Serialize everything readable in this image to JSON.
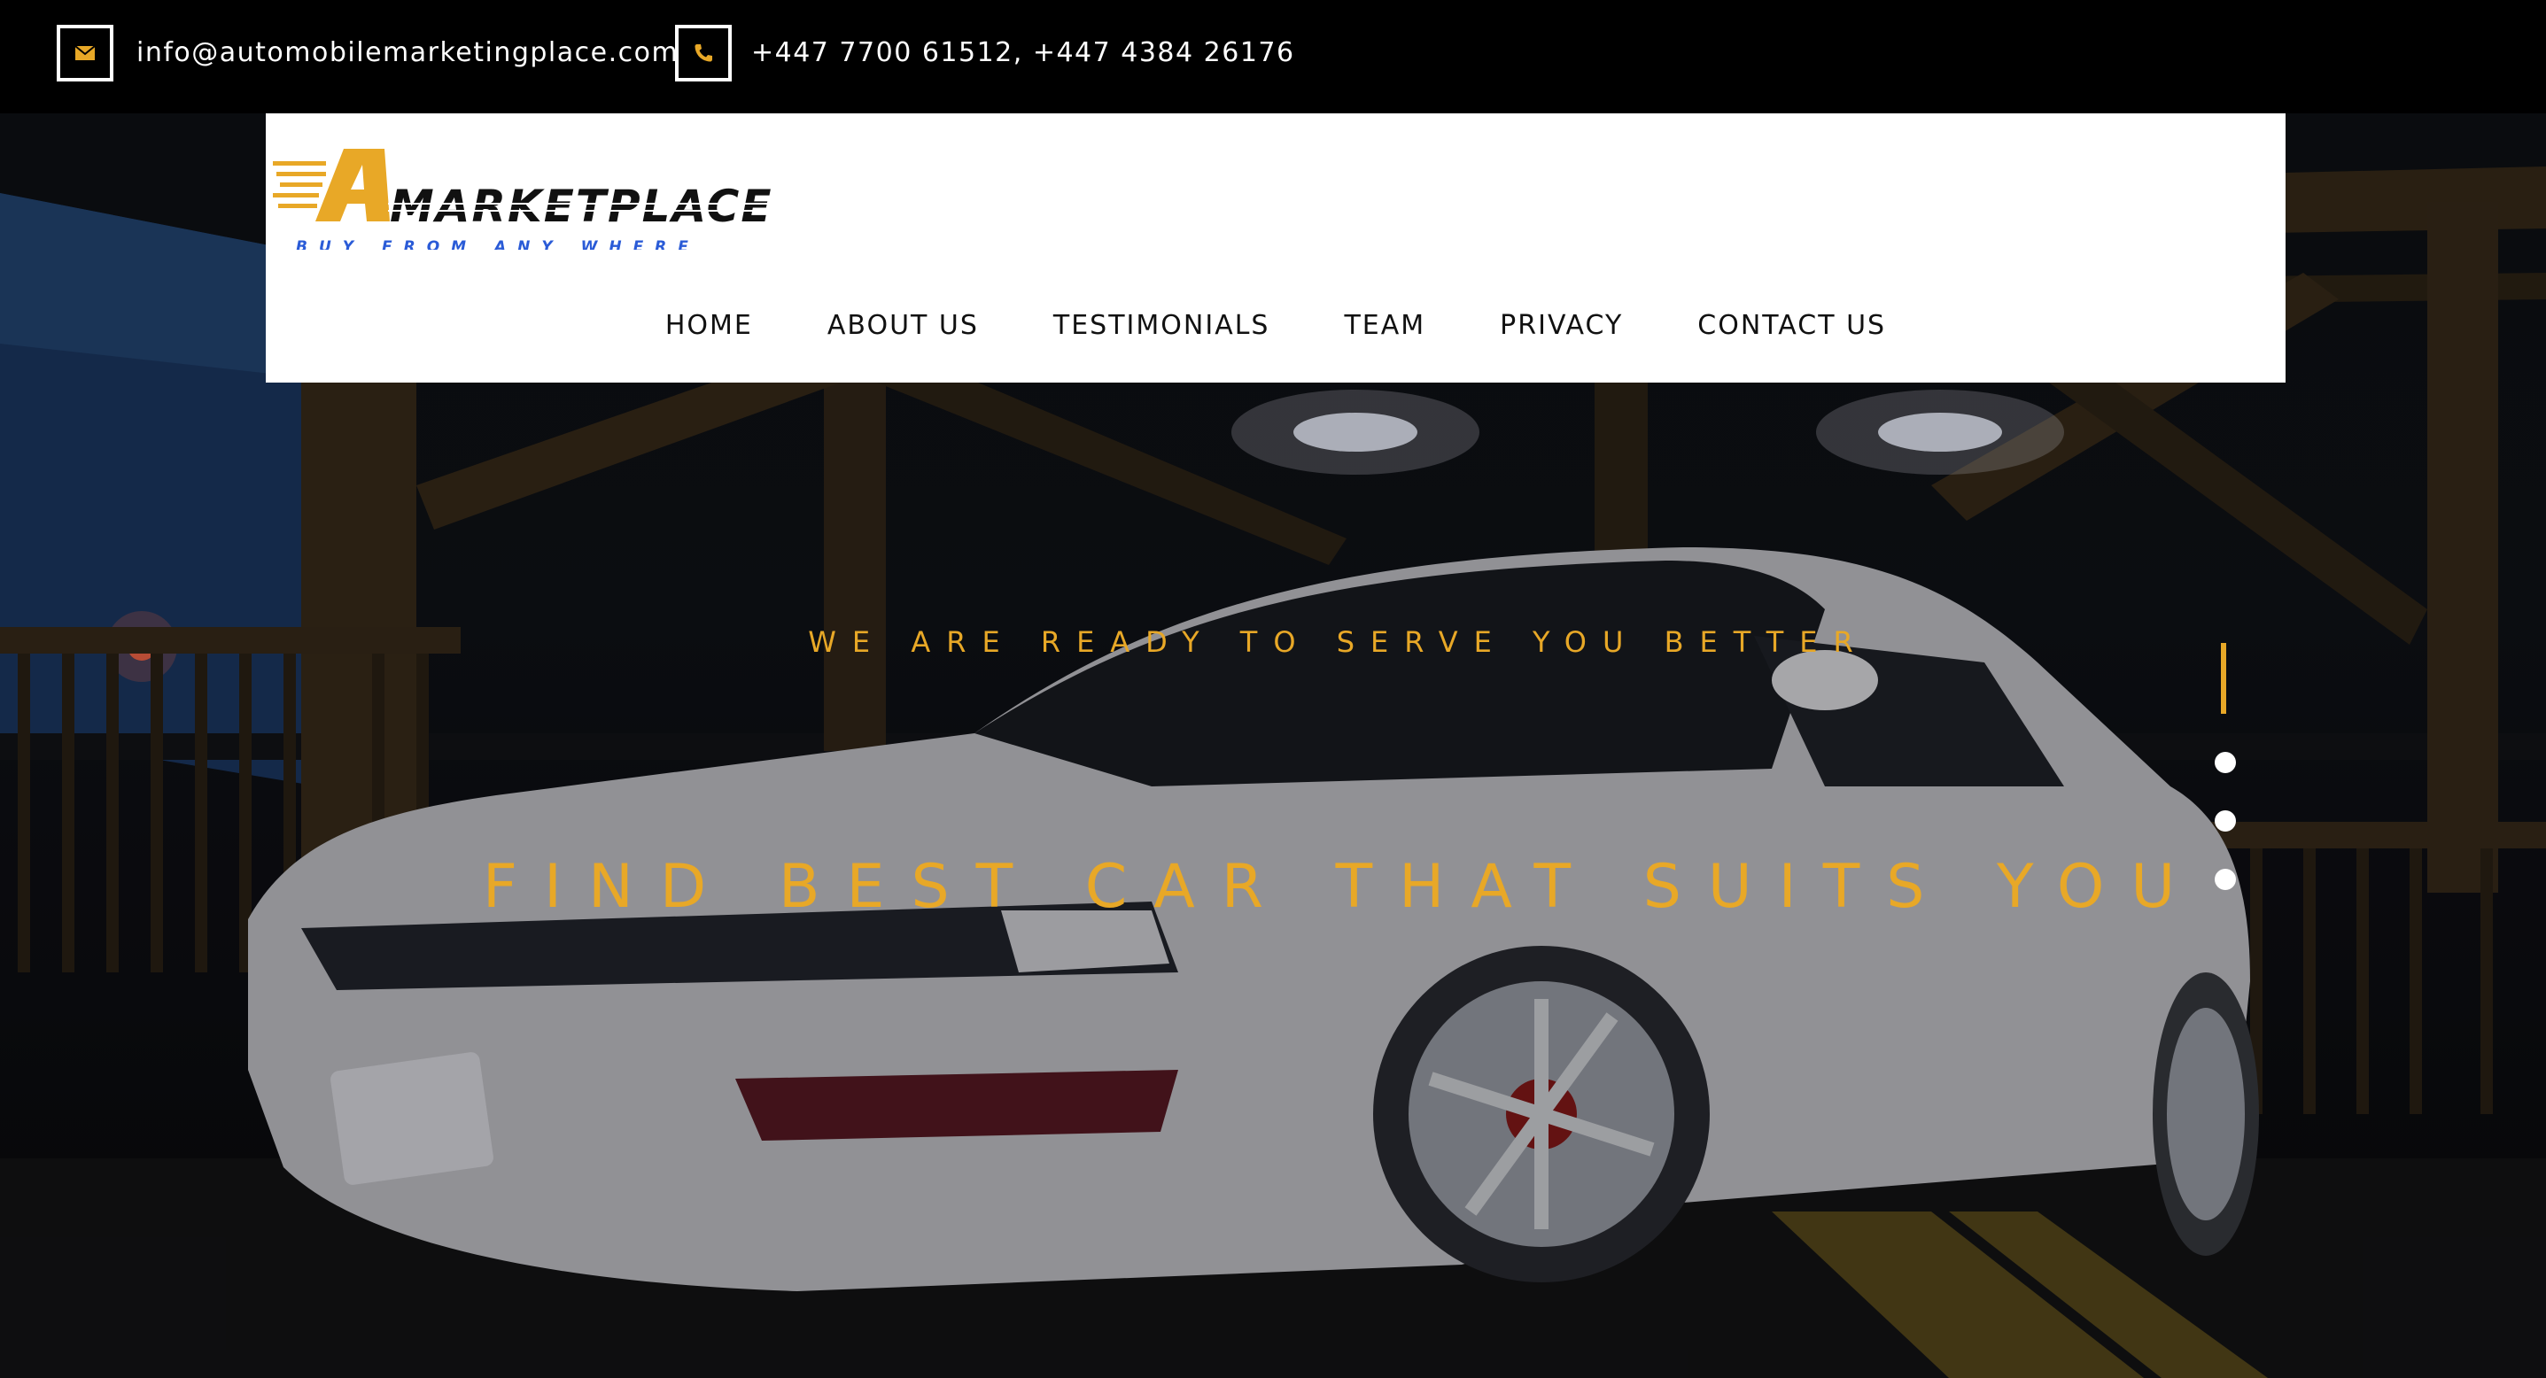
{
  "contact": {
    "email": "info@automobilemarketingplace.com",
    "phone": "+447 7700 61512, +447 4384 26176",
    "email_icon": "envelope-icon",
    "phone_icon": "phone-icon"
  },
  "brand": {
    "logo_letter": "A",
    "logo_word": "MARKETPLACE",
    "logo_tagline": "BUY FROM ANY WHERE"
  },
  "nav": {
    "items": [
      {
        "label": "HOME"
      },
      {
        "label": "ABOUT US"
      },
      {
        "label": "TESTIMONIALS"
      },
      {
        "label": "TEAM"
      },
      {
        "label": "PRIVACY"
      },
      {
        "label": "CONTACT US"
      }
    ]
  },
  "hero": {
    "tagline": "WE ARE READY TO SERVE YOU BETTER",
    "headline": "FIND BEST CAR THAT SUITS YOU",
    "slides_total": 4,
    "active_slide": 1
  },
  "colors": {
    "accent": "#e8a827",
    "topbar": "#000000",
    "header_bg": "#ffffff",
    "logo_blue": "#2a5bd7"
  }
}
